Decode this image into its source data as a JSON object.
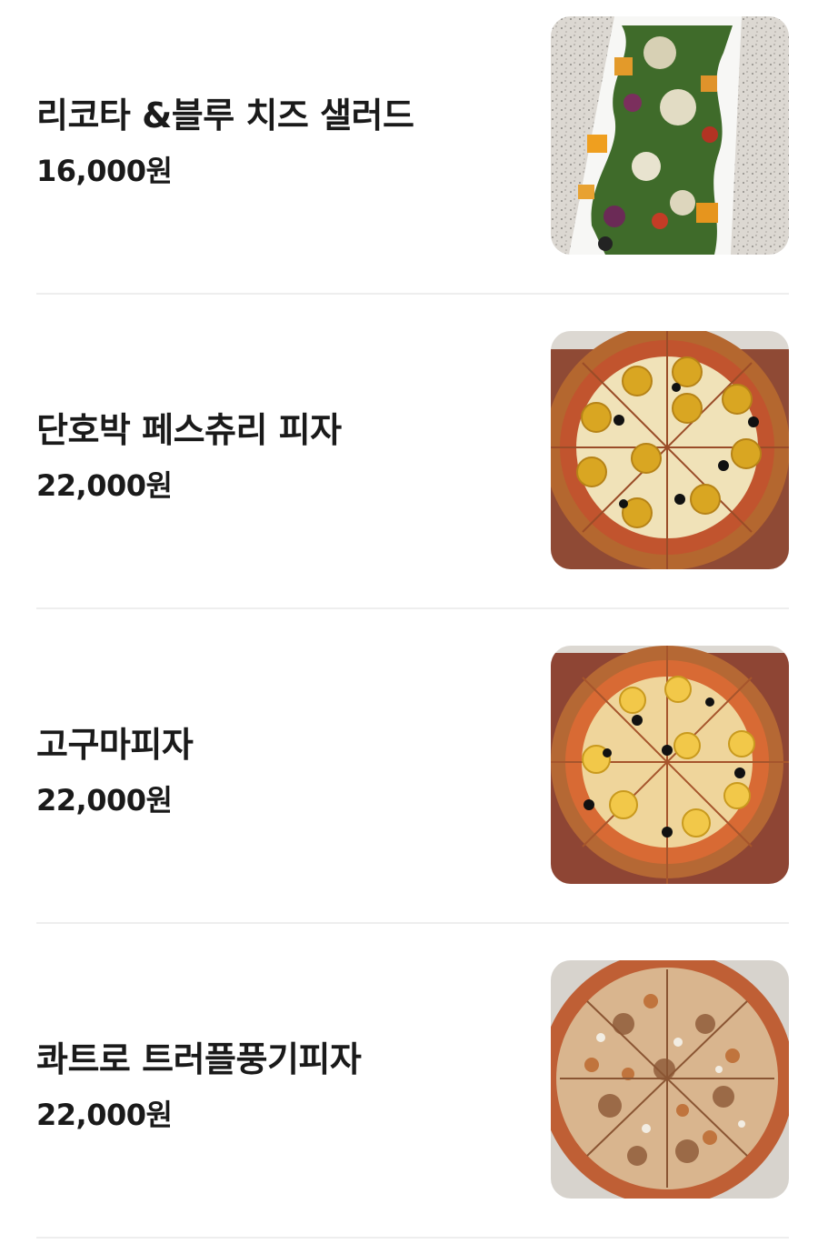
{
  "menu": {
    "items": [
      {
        "name": "리코타 &블루 치즈 샐러드",
        "price": "16,000원",
        "image": "salad-photo"
      },
      {
        "name": "단호박 페스츄리 피자",
        "price": "22,000원",
        "image": "pumpkin-pastry-pizza-photo"
      },
      {
        "name": "고구마피자",
        "price": "22,000원",
        "image": "sweet-potato-pizza-photo"
      },
      {
        "name": "콰트로 트러플풍기피자",
        "price": "22,000원",
        "image": "quattro-truffle-funghi-pizza-photo"
      }
    ]
  },
  "colors": {
    "text": "#1a1a1a",
    "divider": "#eeeeee",
    "background": "#ffffff"
  }
}
